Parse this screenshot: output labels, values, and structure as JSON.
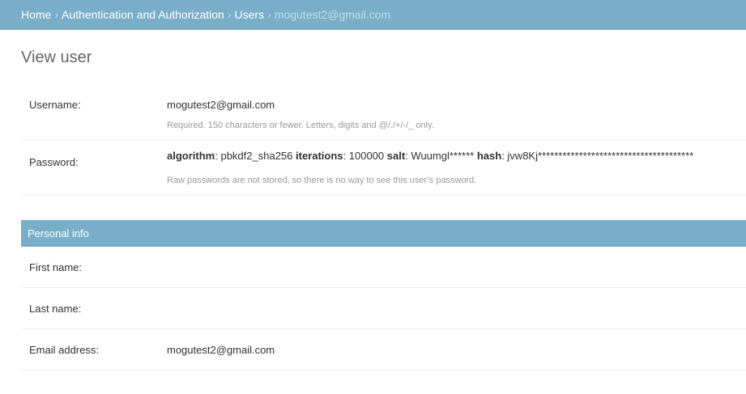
{
  "breadcrumbs": {
    "home": "Home",
    "app": "Authentication and Authorization",
    "model": "Users",
    "current": "mogutest2@gmail.com",
    "separator": "›"
  },
  "title": "View user",
  "fields": {
    "username": {
      "label": "Username:",
      "value": "mogutest2@gmail.com",
      "help": "Required. 150 characters or fewer. Letters, digits and @/./+/-/_ only."
    },
    "password": {
      "label": "Password:",
      "algorithm_key": "algorithm",
      "algorithm": "pbkdf2_sha256",
      "iterations_key": "iterations",
      "iterations": "100000",
      "salt_key": "salt",
      "salt": "Wuumgl******",
      "hash_key": "hash",
      "hash": "jvw8Kj**************************************",
      "help": "Raw passwords are not stored, so there is no way to see this user’s password."
    }
  },
  "personal": {
    "title": "Personal info",
    "first_name": {
      "label": "First name:",
      "value": ""
    },
    "last_name": {
      "label": "Last name:",
      "value": ""
    },
    "email": {
      "label": "Email address:",
      "value": "mogutest2@gmail.com"
    }
  },
  "colors": {
    "header": "#79aec8"
  }
}
